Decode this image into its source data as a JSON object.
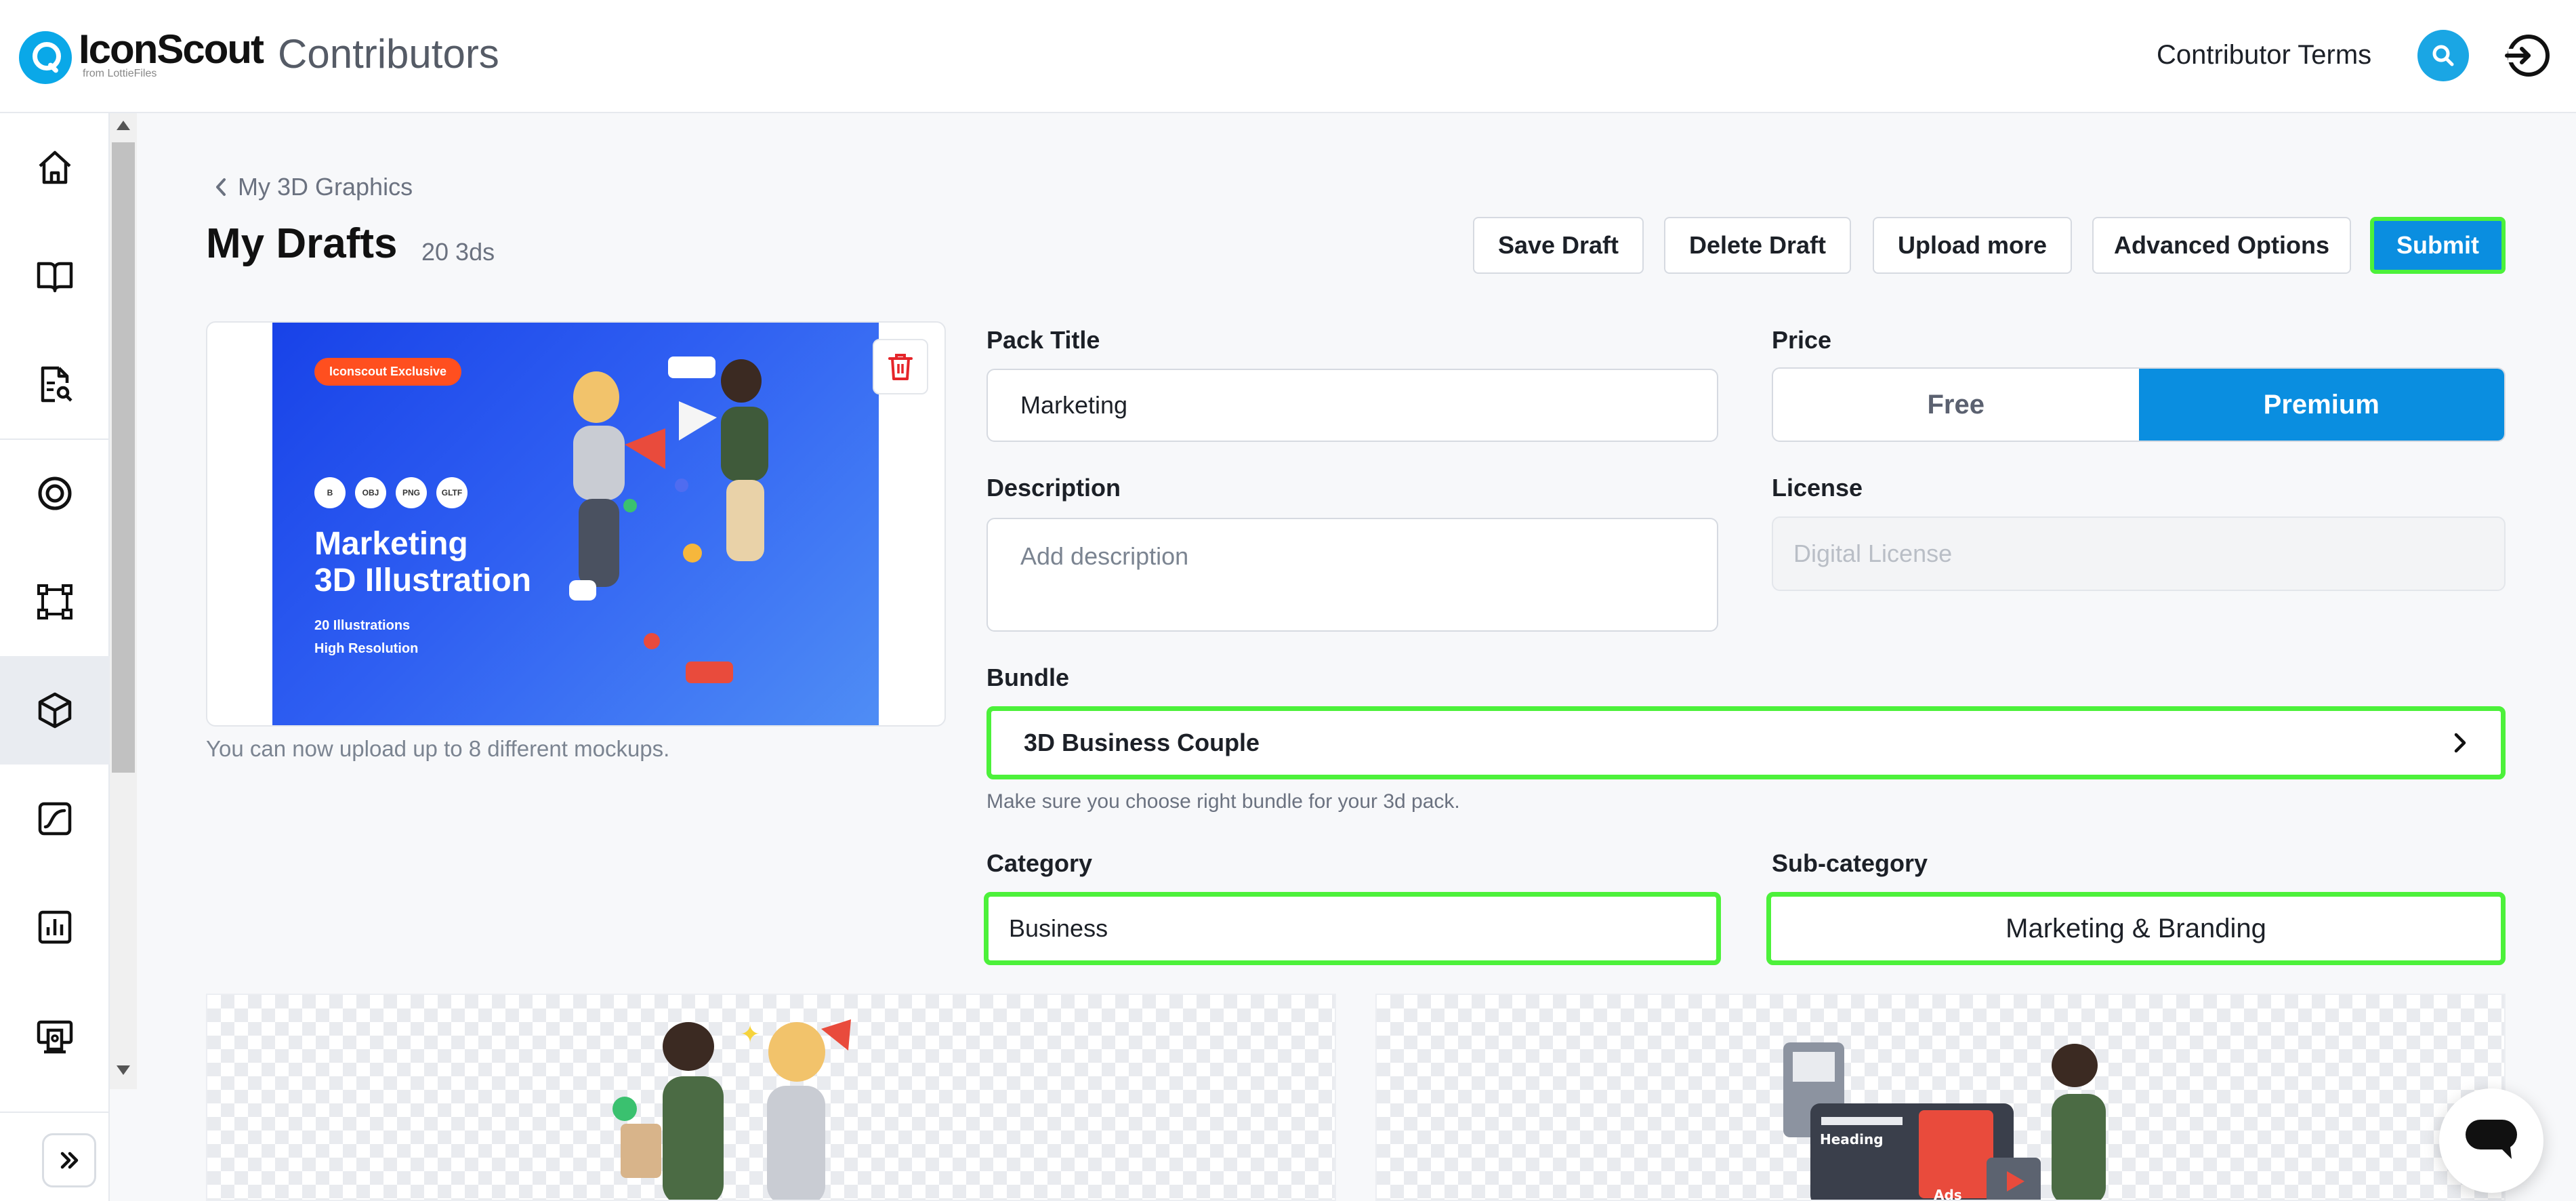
{
  "header": {
    "logo_name": "IconScout",
    "logo_sub": "from LottieFiles",
    "title": "Contributors",
    "terms_link": "Contributor Terms"
  },
  "sidebar": {
    "items": [
      "home-icon",
      "book-icon",
      "document-search-icon",
      "target-icon",
      "vector-icon",
      "cube-icon",
      "lottie-icon",
      "chart-icon",
      "store-icon"
    ],
    "active_index": 5
  },
  "breadcrumb": {
    "label": "My 3D Graphics"
  },
  "page": {
    "title": "My Drafts",
    "count": "20 3ds"
  },
  "toolbar": {
    "save_draft": "Save Draft",
    "delete_draft": "Delete Draft",
    "upload_more": "Upload more",
    "advanced_options": "Advanced Options",
    "submit": "Submit"
  },
  "preview": {
    "tag": "Iconscout Exclusive",
    "formats": [
      "B",
      "OBJ",
      "PNG",
      "GLTF"
    ],
    "heading_line1": "Marketing",
    "heading_line2": "3D Illustration",
    "line1": "20 Illustrations",
    "line2": "High Resolution",
    "upload_hint": "You can now upload up to 8 different mockups."
  },
  "form": {
    "pack_title_label": "Pack Title",
    "pack_title_value": "Marketing",
    "price_label": "Price",
    "price_free": "Free",
    "price_premium": "Premium",
    "price_selected": "Premium",
    "description_label": "Description",
    "description_placeholder": "Add description",
    "license_label": "License",
    "license_placeholder": "Digital License",
    "bundle_label": "Bundle",
    "bundle_value": "3D Business Couple",
    "bundle_hint": "Make sure you choose right bundle for your 3d pack.",
    "category_label": "Category",
    "category_value": "Business",
    "subcategory_label": "Sub-category",
    "subcategory_value": "Marketing & Branding"
  },
  "mockups": {
    "second_heading": "Heading",
    "second_button": "Ads"
  },
  "colors": {
    "accent": "#0a8ee0",
    "brand": "#0aa8e8",
    "highlight": "#4cf13a",
    "danger": "#e5252a"
  }
}
